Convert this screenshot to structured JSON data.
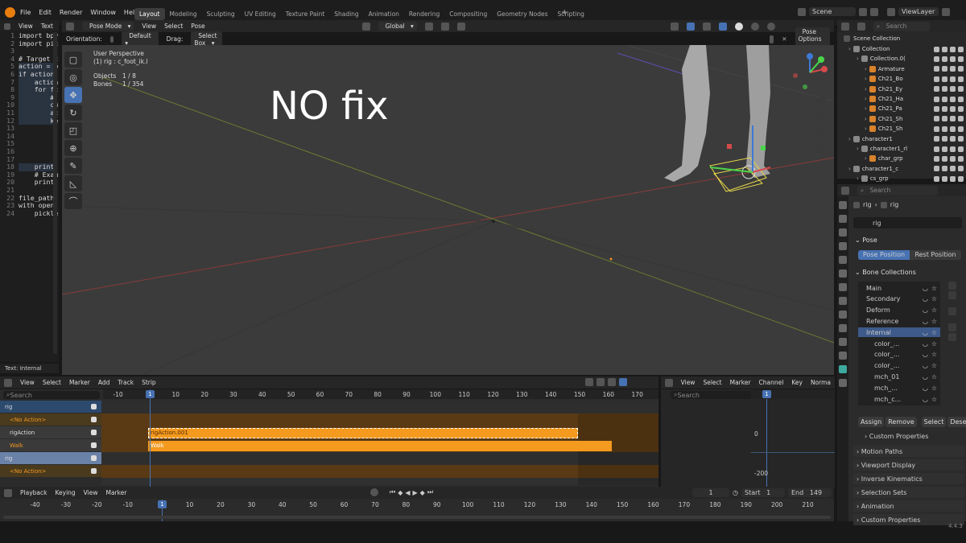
{
  "menu": [
    "File",
    "Edit",
    "Render",
    "Window",
    "Help"
  ],
  "workspaces": [
    "Layout",
    "Modeling",
    "Sculpting",
    "UV Editing",
    "Texture Paint",
    "Shading",
    "Animation",
    "Rendering",
    "Compositing",
    "Geometry Nodes",
    "Scripting"
  ],
  "scene": "Scene",
  "view_layer": "ViewLayer",
  "text_editor": {
    "menu": [
      "View",
      "Text"
    ],
    "status": "Text: Internal",
    "lines": [
      {
        "n": "1",
        "t": "import bpy"
      },
      {
        "n": "2",
        "t": "import pic"
      },
      {
        "n": "3",
        "t": ""
      },
      {
        "n": "4",
        "t": "# Target t"
      },
      {
        "n": "5",
        "t": "action = b"
      },
      {
        "n": "6",
        "t": "if action:"
      },
      {
        "n": "7",
        "t": "    action"
      },
      {
        "n": "8",
        "t": "    for fc"
      },
      {
        "n": "9",
        "t": "        #"
      },
      {
        "n": "10",
        "t": "        cu"
      },
      {
        "n": "11",
        "t": "        ac"
      },
      {
        "n": "12",
        "t": "        ke"
      },
      {
        "n": "13",
        "t": ""
      },
      {
        "n": "14",
        "t": ""
      },
      {
        "n": "15",
        "t": ""
      },
      {
        "n": "16",
        "t": ""
      },
      {
        "n": "17",
        "t": ""
      },
      {
        "n": "18",
        "t": "    print("
      },
      {
        "n": "19",
        "t": "    # Exam"
      },
      {
        "n": "20",
        "t": "    print("
      },
      {
        "n": "21",
        "t": ""
      },
      {
        "n": "22",
        "t": "file_path "
      },
      {
        "n": "23",
        "t": "with open("
      },
      {
        "n": "24",
        "t": "    pickle"
      }
    ]
  },
  "viewport": {
    "mode": "Pose Mode",
    "menu": [
      "View",
      "Select",
      "Pose"
    ],
    "orientation_label": "Orientation:",
    "orientation": "Default",
    "drag_label": "Drag:",
    "drag": "Select Box",
    "transform": "Global",
    "pose_options": "Pose Options",
    "perspective": "User Perspective",
    "active": "(1) rig : c_foot_ik.l",
    "objects_label": "Objects",
    "objects": "1 / 8",
    "bones_label": "Bones",
    "bones": "1 / 354",
    "overlay_text": "NO fix",
    "axes": {
      "x": "X",
      "y": "Y",
      "z": "Z"
    }
  },
  "outliner": {
    "search_placeholder": "Search",
    "title": "Scene Collection",
    "items": [
      {
        "label": "Collection",
        "indent": 0
      },
      {
        "label": "Collection.0(",
        "indent": 1
      },
      {
        "label": "Armature",
        "indent": 2
      },
      {
        "label": "Ch21_Bo",
        "indent": 2
      },
      {
        "label": "Ch21_Ey",
        "indent": 2
      },
      {
        "label": "Ch21_Ha",
        "indent": 2
      },
      {
        "label": "Ch21_Pa",
        "indent": 2
      },
      {
        "label": "Ch21_Sh",
        "indent": 2
      },
      {
        "label": "Ch21_Sh",
        "indent": 2
      },
      {
        "label": "character1",
        "indent": 0
      },
      {
        "label": "character1_rl",
        "indent": 1
      },
      {
        "label": "char_grp",
        "indent": 2
      },
      {
        "label": "character1_c",
        "indent": 0
      },
      {
        "label": "cs_grp",
        "indent": 1
      }
    ]
  },
  "properties": {
    "search_placeholder": "Search",
    "breadcrumb": [
      "rig",
      "rig"
    ],
    "name": "rig",
    "pose_header": "Pose",
    "pose_position": "Pose Position",
    "rest_position": "Rest Position",
    "bone_collections_header": "Bone Collections",
    "bone_collections": [
      "Main",
      "Secondary",
      "Deform",
      "Reference",
      "Internal",
      "color_...",
      "color_...",
      "color_...",
      "mch_01",
      "mch_...",
      "mch_c..."
    ],
    "buttons": [
      "Assign",
      "Remove",
      "Select",
      "Deselect"
    ],
    "custom_properties_sub": "Custom Properties",
    "panels": [
      "Motion Paths",
      "Viewport Display",
      "Inverse Kinematics",
      "Selection Sets",
      "Animation",
      "Custom Properties"
    ]
  },
  "nla": {
    "menu": [
      "View",
      "Select",
      "Marker",
      "Add",
      "Track",
      "Strip"
    ],
    "search_placeholder": "Search",
    "ticks": [
      "-10",
      "1",
      "10",
      "20",
      "30",
      "40",
      "50",
      "60",
      "70",
      "80",
      "90",
      "100",
      "110",
      "120",
      "130",
      "140",
      "150",
      "160",
      "170"
    ],
    "tracks": [
      {
        "label": "rig"
      },
      {
        "label": "<No Action>"
      },
      {
        "label": "rigAction"
      },
      {
        "label": "Walk"
      },
      {
        "label": "rig"
      },
      {
        "label": "<No Action>"
      }
    ],
    "strips": [
      "rigAction.001",
      "Walk"
    ]
  },
  "graph": {
    "menu": [
      "View",
      "Select",
      "Marker",
      "Channel",
      "Key",
      "Norma"
    ],
    "search_placeholder": "Search",
    "frame": "1",
    "values": [
      "0",
      "-200"
    ]
  },
  "timeline": {
    "menu": [
      "Playback",
      "Keying",
      "View",
      "Marker"
    ],
    "current_frame": "1",
    "start_label": "Start",
    "start": "1",
    "end_label": "End",
    "end": "149",
    "ticks": [
      "-40",
      "-30",
      "-20",
      "-10",
      "1",
      "10",
      "20",
      "30",
      "40",
      "50",
      "60",
      "70",
      "80",
      "90",
      "100",
      "110",
      "120",
      "130",
      "140",
      "150",
      "160",
      "170",
      "180",
      "190",
      "200",
      "210"
    ]
  },
  "version": "4.4.3"
}
